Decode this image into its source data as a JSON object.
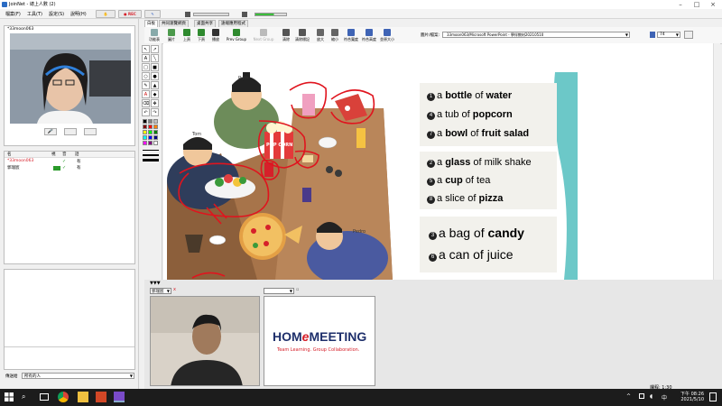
{
  "window": {
    "title": "JoinNet - 總上人數 (2)"
  },
  "menu": {
    "items": [
      "檔案(F)",
      "工具(T)",
      "設定(S)",
      "說明(H)"
    ],
    "rec_label": "● REC"
  },
  "self_video": {
    "name": "*33moon063"
  },
  "participants": {
    "headers": [
      "名",
      "視",
      "音",
      "話"
    ],
    "rows": [
      {
        "name": "*33moon063",
        "check": "✓",
        "status": "有"
      },
      {
        "name": "郭瑞宸",
        "check": "✓",
        "status": "有"
      }
    ]
  },
  "chat": {
    "send_to_label": "傳送給",
    "send_to_value": "所有的人"
  },
  "tabs": [
    "白板",
    "共同瀏覽網頁",
    "桌面共享",
    "遠端應用程式"
  ],
  "toolbar": {
    "tools": [
      "功能表",
      "圖片",
      "上頁",
      "下頁",
      "播放",
      "Prev Group",
      "Next Group",
      "清除",
      "清除標記",
      "放大",
      "縮小",
      "符合寬度",
      "符合高度",
      "並原大小"
    ],
    "file_label": "圖片/檔案:",
    "file_value": "33moon063/Microsoft PowerPoint - 學伴教材20210510",
    "page_value": "74"
  },
  "slide": {
    "labels": {
      "ruth": "Ruth",
      "tom": "Tom",
      "pedro": "Pedro",
      "popcorn_sign": "POP CORN"
    },
    "group1": [
      {
        "n": "1",
        "pre": "a ",
        "bold": "bottle",
        "mid": " of ",
        "bold2": "water"
      },
      {
        "n": "4",
        "pre": "a tub of ",
        "bold": "popcorn",
        "mid": "",
        "bold2": ""
      },
      {
        "n": "7",
        "pre": "a ",
        "bold": "bowl",
        "mid": " of ",
        "bold2": "fruit salad"
      }
    ],
    "group2": [
      {
        "n": "2",
        "pre": "a ",
        "bold": "glass",
        "mid": " of milk shake",
        "bold2": ""
      },
      {
        "n": "5",
        "pre": "a ",
        "bold": "cup",
        "mid": " of tea",
        "bold2": ""
      },
      {
        "n": "8",
        "pre": "a slice of ",
        "bold": "pizza",
        "mid": "",
        "bold2": ""
      }
    ],
    "group3": [
      {
        "n": "3",
        "pre": "a bag of ",
        "bold": "candy",
        "mid": "",
        "bold2": ""
      },
      {
        "n": "6",
        "pre": "a can of juice",
        "bold": "",
        "mid": "",
        "bold2": ""
      }
    ]
  },
  "remote_video": {
    "name": "郭瑞宸",
    "mic_flag": "x"
  },
  "brand": {
    "name_left": "HOM",
    "name_e": "e",
    "name_right": "MEETING",
    "tagline": "Team Learning. Group Collaboration."
  },
  "taskbar": {
    "status": "課程: 1:30",
    "time": "下午 08:26",
    "date": "2021/5/10",
    "lang": "中"
  },
  "colors": {
    "accent": "#d6202a",
    "brand_blue": "#1e2f6b",
    "ink_red": "#e0141e"
  }
}
